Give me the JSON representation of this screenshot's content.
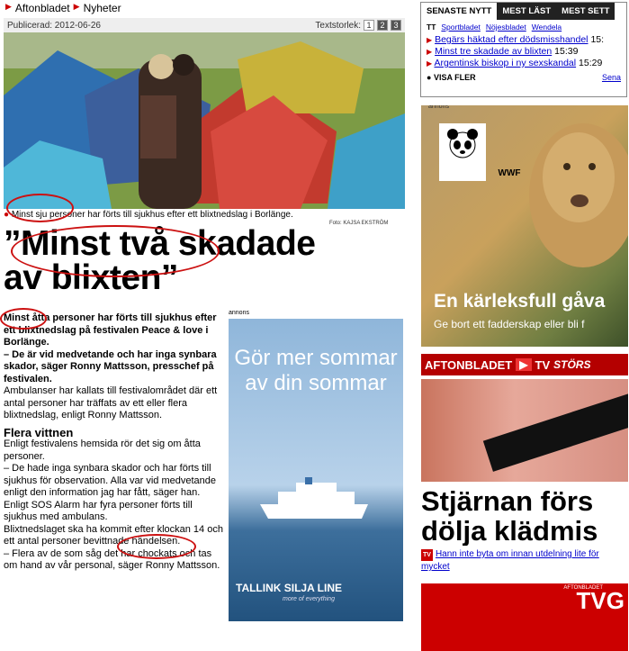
{
  "breadcrumb": [
    "Aftonbladet",
    "Nyheter"
  ],
  "published": "Publicerad: 2012-06-26",
  "textsize": {
    "label": "Textstorlek:",
    "options": [
      "1",
      "2",
      "3"
    ]
  },
  "caption": "Minst sju personer har förts till sjukhus efter ett blixtnedslag i Borlänge.",
  "photo_credit": "Foto: KAJSA EKSTRÖM",
  "headline_line1": "”Minst två skadade",
  "headline_line2": "av blixten”",
  "article": {
    "lead": "Minst åtta personer har förts till sjukhus efter ett blixtnedslag på festivalen Peace & love i Borlänge.",
    "quote1": "– De är vid medvetande och har inga synbara skador, säger Ronny Mattsson, presschef på festivalen.",
    "p1": "Ambulanser har kallats till festivalområdet där ett antal personer har träffats av ett eller flera blixtnedslag, enligt Ronny Mattsson.",
    "subhead": "Flera vittnen",
    "p2": "Enligt festivalens hemsida rör det sig om åtta personer.",
    "p3": "– De hade inga synbara skador och har förts till sjukhus för observation. Alla var vid medvetande enligt den information jag har fått, säger han.",
    "p4": "Enligt SOS Alarm har fyra personer förts till sjukhus med ambulans.",
    "p5": "Blixtnedslaget ska ha kommit efter klockan 14 och ett antal personer bevittnade händelsen.",
    "p6": "– Flera av de som såg det har chockats och tas om hand av vår personal, säger Ronny Mattsson."
  },
  "ad_left": {
    "annons": "annons",
    "slogan": "Gör mer sommar av din sommar",
    "brand": "TALLINK SILJA LINE",
    "tagline": "more of everything"
  },
  "sidebar": {
    "tabs": [
      "SENASTE NYTT",
      "MEST LÄST",
      "MEST SETT"
    ],
    "filter_tt": "TT",
    "filters": [
      "Sportbladet",
      "Nöjesbladet",
      "Wendela"
    ],
    "news": [
      {
        "title": "Begärs häktad efter dödsmisshandel",
        "time": "15:"
      },
      {
        "title": "Minst tre skadade av blixten",
        "time": "15:39"
      },
      {
        "title": "Argentinsk biskop i ny sexskandal",
        "time": "15:29"
      }
    ],
    "visa_fler": "VISA FLER",
    "more_link": "Sena"
  },
  "ad_wwf": {
    "annons": "annons",
    "logo_text": "WWF",
    "headline": "En kärleksfull gåva",
    "sub": "Ge bort ett fadderskap eller bli f"
  },
  "tv_bar": {
    "brand": "AFTONBLADET",
    "tv": "TV",
    "stors": "STÖRS"
  },
  "tv_headline_line1": "Stjärnan förs",
  "tv_headline_line2": "dölja klädmis",
  "tv_link": {
    "badge": "TV",
    "text": "Hann inte byta om innan utdelning lite för mycket"
  },
  "tv_foot": {
    "small": "AFTONBLADET",
    "logo": "TVG"
  }
}
